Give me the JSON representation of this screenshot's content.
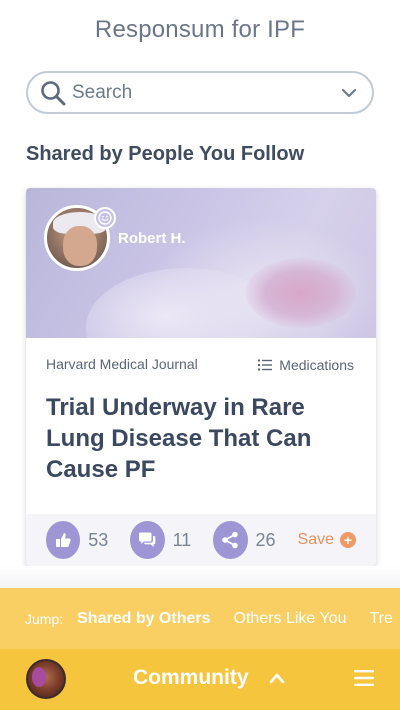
{
  "app": {
    "title": "Responsum for IPF"
  },
  "search": {
    "placeholder": "Search"
  },
  "section": {
    "title": "Shared by People You Follow"
  },
  "card": {
    "sharer_name": "Robert H.",
    "source": "Harvard Medical Journal",
    "category": "Medications",
    "headline": "Trial Underway in Rare Lung Disease That Can Cause PF",
    "actions": {
      "likes": "53",
      "comments": "11",
      "shares": "26",
      "save_label": "Save"
    }
  },
  "jump": {
    "label": "Jump:",
    "items": [
      "Shared by Others",
      "Others Like You",
      "Tre"
    ]
  },
  "bottom_nav": {
    "label": "Community"
  },
  "icons": {
    "search": "search-icon",
    "dropdown": "chevron-down-icon",
    "badge": "smiley-icon",
    "list": "list-icon",
    "like": "thumbs-up-icon",
    "comment": "comment-icon",
    "share": "share-icon",
    "save": "plus-circle-icon",
    "expand": "chevron-up-icon",
    "menu": "hamburger-menu-icon"
  },
  "colors": {
    "accent_purple": "#9e95d4",
    "jump_bar": "#f9cf64",
    "bottom_bar": "#f6c53e",
    "save_orange": "#e8915a"
  }
}
